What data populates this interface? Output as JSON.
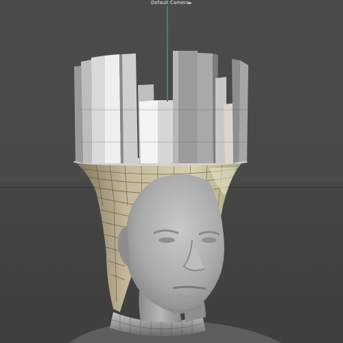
{
  "viewport": {
    "camera_label": "Default Camera"
  },
  "icons": [
    "camera-icon"
  ]
}
